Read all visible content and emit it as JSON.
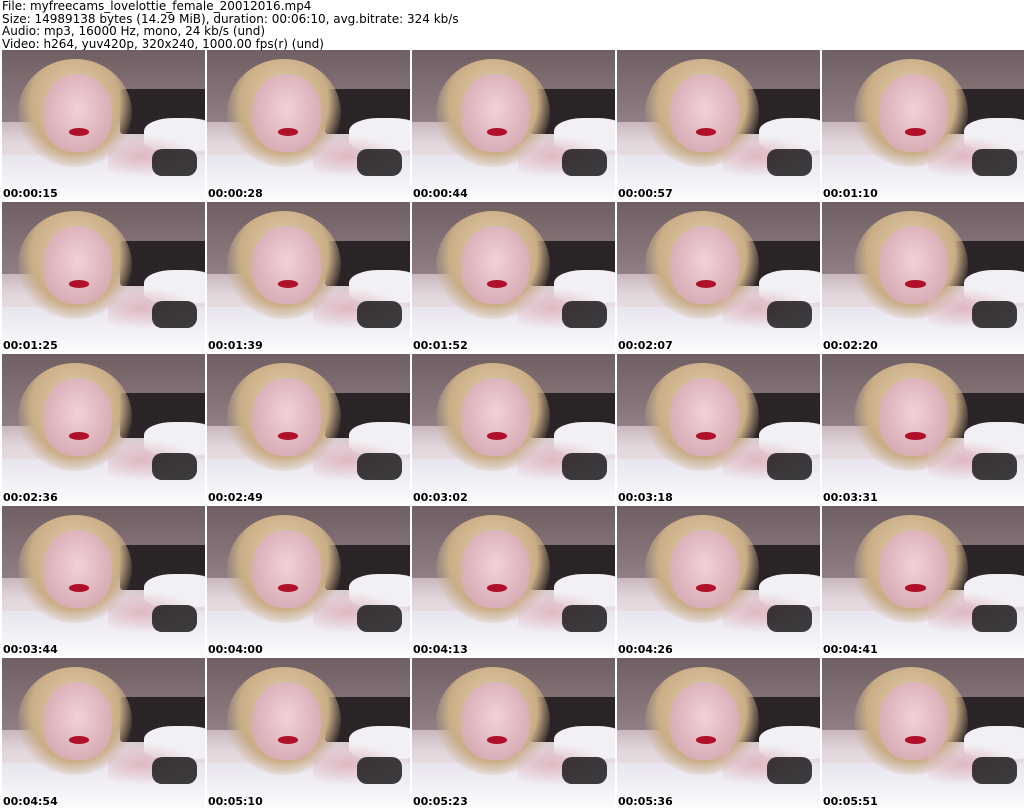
{
  "header": {
    "file_line": "File: myfreecams_lovelottie_female_20012016.mp4",
    "size_line": "Size: 14989138 bytes (14.29 MiB), duration: 00:06:10, avg.bitrate: 324 kb/s",
    "audio_line": "Audio: mp3, 16000 Hz, mono, 24 kb/s (und)",
    "video_line": "Video: h264, yuv420p, 320x240, 1000.00 fps(r) (und)"
  },
  "thumbnails": [
    {
      "timestamp": "00:00:15"
    },
    {
      "timestamp": "00:00:28"
    },
    {
      "timestamp": "00:00:44"
    },
    {
      "timestamp": "00:00:57"
    },
    {
      "timestamp": "00:01:10"
    },
    {
      "timestamp": "00:01:25"
    },
    {
      "timestamp": "00:01:39"
    },
    {
      "timestamp": "00:01:52"
    },
    {
      "timestamp": "00:02:07"
    },
    {
      "timestamp": "00:02:20"
    },
    {
      "timestamp": "00:02:36"
    },
    {
      "timestamp": "00:02:49"
    },
    {
      "timestamp": "00:03:02"
    },
    {
      "timestamp": "00:03:18"
    },
    {
      "timestamp": "00:03:31"
    },
    {
      "timestamp": "00:03:44"
    },
    {
      "timestamp": "00:04:00"
    },
    {
      "timestamp": "00:04:13"
    },
    {
      "timestamp": "00:04:26"
    },
    {
      "timestamp": "00:04:41"
    },
    {
      "timestamp": "00:04:54"
    },
    {
      "timestamp": "00:05:10"
    },
    {
      "timestamp": "00:05:23"
    },
    {
      "timestamp": "00:05:36"
    },
    {
      "timestamp": "00:05:51"
    }
  ]
}
